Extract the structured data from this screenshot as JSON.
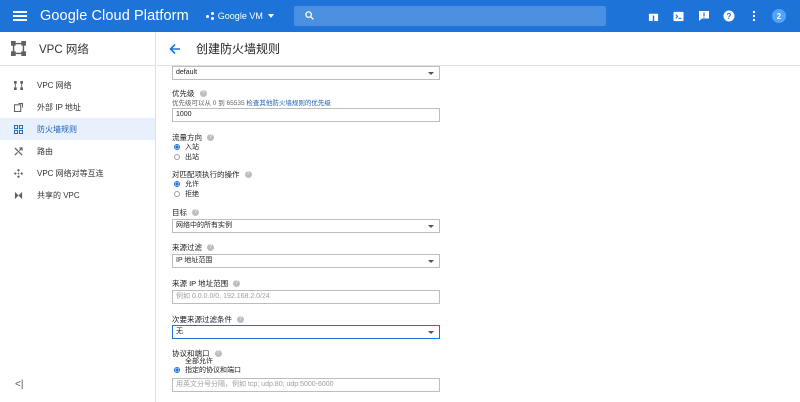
{
  "topbar": {
    "brand": "Google Cloud Platform",
    "project": "Google VM",
    "avatar_letter": "2"
  },
  "sidebar": {
    "title": "VPC 网络",
    "items": [
      {
        "label": "VPC 网络",
        "icon": "vpc-network-icon"
      },
      {
        "label": "外部 IP 地址",
        "icon": "external-ip-icon"
      },
      {
        "label": "防火墙规则",
        "icon": "firewall-grid-icon",
        "active": true
      },
      {
        "label": "路由",
        "icon": "routes-icon"
      },
      {
        "label": "VPC 网络对等互连",
        "icon": "peering-icon"
      },
      {
        "label": "共享的 VPC",
        "icon": "shared-vpc-icon"
      }
    ],
    "collapse_label": "<|"
  },
  "page": {
    "title": "创建防火墙规则"
  },
  "form": {
    "network_value": "default",
    "priority_label": "优先级",
    "priority_hint": "优先级可以从 0 到 65535",
    "priority_link": "检查其他防火墙规则的优先级",
    "priority_value": "1000",
    "direction_label": "流量方向",
    "direction_options": [
      "入站",
      "出站"
    ],
    "action_label": "对匹配项执行的操作",
    "action_options": [
      "允许",
      "拒绝"
    ],
    "target_label": "目标",
    "target_value": "网络中的所有实例",
    "source_filter_label": "来源过滤",
    "source_filter_value": "IP 地址范围",
    "source_ip_label": "来源 IP 地址范围",
    "source_ip_placeholder": "例如 0.0.0.0/0, 192.168.2.0/24",
    "secondary_filter_label": "次要来源过滤条件",
    "secondary_filter_value": "无",
    "protocols_label": "协议和端口",
    "protocols_options": [
      "全部允许",
      "指定的协议和端口"
    ],
    "protocols_placeholder": "用英文分号分隔，例如 tcp; udp:80; udp:5000-6000"
  },
  "colors": {
    "accent": "#1e73d9",
    "active_bg": "#e8f0fe"
  }
}
